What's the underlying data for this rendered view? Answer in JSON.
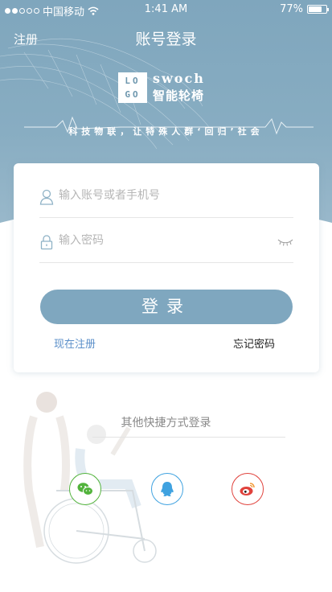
{
  "status_bar": {
    "carrier": "中国移动",
    "time": "1:41 AM",
    "battery": "77%",
    "battery_level": 0.77,
    "signal_bars_filled": 2,
    "signal_bars_total": 5
  },
  "nav": {
    "register": "注册",
    "title": "账号登录"
  },
  "brand": {
    "logo_line1": "LO",
    "logo_line2": "GO",
    "name_en": "swoch",
    "name_cn": "智能轮椅",
    "slogan": "科技物联，让特殊人群‘回归’社会"
  },
  "login_form": {
    "account_placeholder": "输入账号或者手机号",
    "password_placeholder": "输入密码",
    "login_button": "登录",
    "register_now": "现在注册",
    "forgot_password": "忘记密码"
  },
  "other_login": {
    "title": "其他快捷方式登录",
    "options": [
      "wechat-icon",
      "qq-icon",
      "weibo-icon"
    ]
  },
  "colors": {
    "header": "#84aac0",
    "accent_button": "#7fa7bf",
    "link": "#5b8fc9",
    "wechat": "#52b33c",
    "qq": "#3fa2e0",
    "weibo": "#e0423c"
  }
}
